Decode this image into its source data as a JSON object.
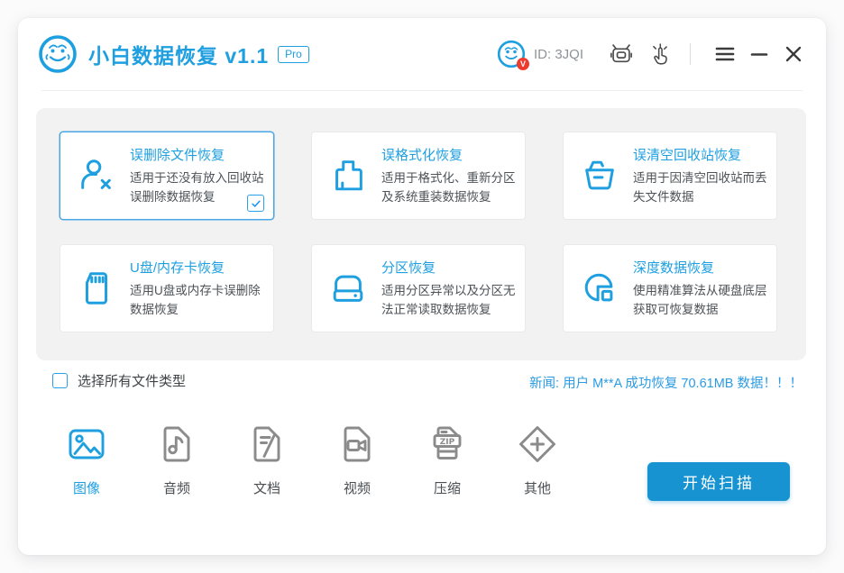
{
  "window": {
    "title": "小白数据恢复 v1.1",
    "badge": "Pro",
    "user_id": "ID: 3JQI"
  },
  "colors": {
    "accent": "#1E9FE0",
    "button": "#1793D2",
    "selected_border": "#49A7E6",
    "v_badge": "#EE3B2E"
  },
  "cards": [
    {
      "title": "误删除文件恢复",
      "desc": "适用于还没有放入回收站误删除数据恢复",
      "icon": "user-remove-icon",
      "selected": true,
      "checked": true
    },
    {
      "title": "误格式化恢复",
      "desc": "适用于格式化、重新分区及系统重装数据恢复",
      "icon": "format-brush-icon"
    },
    {
      "title": "误清空回收站恢复",
      "desc": "适用于因清空回收站而丢失文件数据",
      "icon": "recycle-bin-icon"
    },
    {
      "title": "U盘/内存卡恢复",
      "desc": "适用U盘或内存卡误删除数据恢复",
      "icon": "sd-card-icon"
    },
    {
      "title": "分区恢复",
      "desc": "适用分区异常以及分区无法正常读取数据恢复",
      "icon": "hard-drive-icon"
    },
    {
      "title": "深度数据恢复",
      "desc": "使用精准算法从硬盘底层获取可恢复数据",
      "icon": "deep-scan-icon"
    }
  ],
  "select_all_label": "选择所有文件类型",
  "news": "新闻: 用户 M**A 成功恢复 70.61MB 数据！！！",
  "filetypes": [
    {
      "label": "图像",
      "icon": "image-file-icon",
      "selected": true
    },
    {
      "label": "音频",
      "icon": "audio-file-icon"
    },
    {
      "label": "文档",
      "icon": "document-file-icon"
    },
    {
      "label": "视频",
      "icon": "video-file-icon"
    },
    {
      "label": "压缩",
      "icon": "zip-file-icon"
    },
    {
      "label": "其他",
      "icon": "other-file-icon"
    }
  ],
  "icons": {
    "zip_text": "ZIP",
    "v_badge_text": "V"
  },
  "scan_button": "开始扫描"
}
